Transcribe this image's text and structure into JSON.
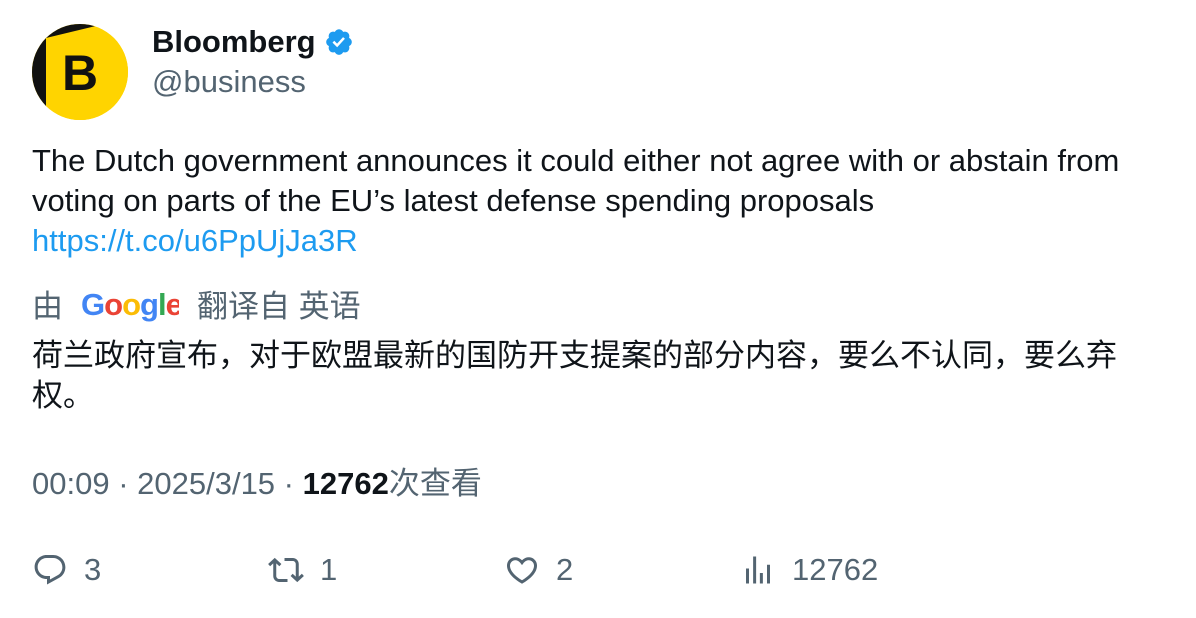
{
  "author": {
    "display_name": "Bloomberg",
    "handle": "@business",
    "avatar_letter": "B",
    "verified_icon": "verified-badge-icon"
  },
  "tweet": {
    "text": "The Dutch government announces it could either not agree with or abstain from voting on parts of the EU’s latest defense spending proposals",
    "link": "https://t.co/u6PpUjJa3R"
  },
  "translation": {
    "by_label": "由",
    "provider": "Google",
    "from_label": "翻译自 英语",
    "text": "荷兰政府宣布，对于欧盟最新的国防开支提案的部分内容，要么不认同，要么弃权。"
  },
  "meta": {
    "time": "00:09",
    "sep1": " · ",
    "date": "2025/3/15",
    "sep2": " · ",
    "views_count": "12762",
    "views_label": "次查看"
  },
  "actions": {
    "replies": "3",
    "retweets": "1",
    "likes": "2",
    "views": "12762"
  },
  "colors": {
    "link": "#1d9bf0",
    "muted": "#536471",
    "text": "#0f1419",
    "brand_yellow": "#ffd400"
  }
}
